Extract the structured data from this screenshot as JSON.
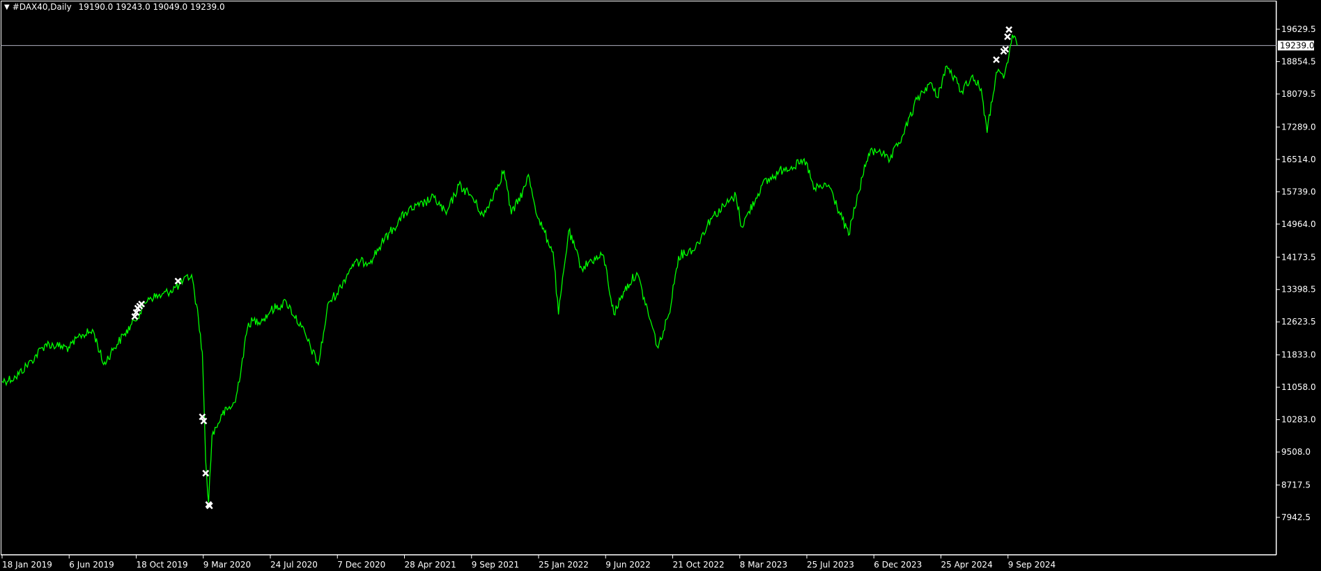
{
  "header": {
    "menu_icon": "triangle-down-icon",
    "symbol": "#DAX40,Daily",
    "ohlc": "19190.0 19243.0 19049.0 19239.0"
  },
  "colors": {
    "background": "#000000",
    "price_line": "#00ff00",
    "axis": "#ffffff",
    "marker": "#ffffff",
    "bid_line": "#b0b0c0"
  },
  "chart_data": {
    "type": "line",
    "series": [
      {
        "name": "",
        "points": [
          [
            "2019-01-18",
            11200
          ],
          [
            "2019-02-15",
            11300
          ],
          [
            "2019-03-20",
            11700
          ],
          [
            "2019-04-18",
            12100
          ],
          [
            "2019-05-10",
            12050
          ],
          [
            "2019-06-06",
            12000
          ],
          [
            "2019-06-28",
            12300
          ],
          [
            "2019-07-25",
            12400
          ],
          [
            "2019-08-15",
            11600
          ],
          [
            "2019-09-05",
            12000
          ],
          [
            "2019-09-25",
            12300
          ],
          [
            "2019-10-18",
            12650
          ],
          [
            "2019-11-15",
            13200
          ],
          [
            "2019-12-12",
            13250
          ],
          [
            "2020-01-17",
            13500
          ],
          [
            "2020-02-12",
            13750
          ],
          [
            "2020-02-26",
            12700
          ],
          [
            "2020-03-05",
            11900
          ],
          [
            "2020-03-12",
            9300
          ],
          [
            "2020-03-18",
            8300
          ],
          [
            "2020-03-25",
            9900
          ],
          [
            "2020-04-15",
            10400
          ],
          [
            "2020-05-12",
            10700
          ],
          [
            "2020-06-08",
            12600
          ],
          [
            "2020-07-10",
            12700
          ],
          [
            "2020-07-24",
            12900
          ],
          [
            "2020-08-25",
            13100
          ],
          [
            "2020-09-25",
            12500
          ],
          [
            "2020-10-30",
            11600
          ],
          [
            "2020-11-20",
            13100
          ],
          [
            "2020-12-07",
            13300
          ],
          [
            "2021-01-08",
            14000
          ],
          [
            "2021-02-15",
            14100
          ],
          [
            "2021-03-15",
            14600
          ],
          [
            "2021-04-28",
            15250
          ],
          [
            "2021-05-25",
            15400
          ],
          [
            "2021-06-25",
            15600
          ],
          [
            "2021-07-20",
            15200
          ],
          [
            "2021-08-15",
            15900
          ],
          [
            "2021-09-09",
            15650
          ],
          [
            "2021-10-05",
            15150
          ],
          [
            "2021-11-16",
            16250
          ],
          [
            "2021-12-01",
            15200
          ],
          [
            "2021-12-31",
            15900
          ],
          [
            "2022-01-05",
            16150
          ],
          [
            "2022-01-25",
            15100
          ],
          [
            "2022-02-25",
            14300
          ],
          [
            "2022-03-08",
            12800
          ],
          [
            "2022-03-29",
            14800
          ],
          [
            "2022-04-25",
            13900
          ],
          [
            "2022-05-15",
            14100
          ],
          [
            "2022-06-09",
            14200
          ],
          [
            "2022-06-30",
            12800
          ],
          [
            "2022-07-20",
            13350
          ],
          [
            "2022-08-16",
            13800
          ],
          [
            "2022-09-29",
            12000
          ],
          [
            "2022-10-21",
            12800
          ],
          [
            "2022-11-10",
            14200
          ],
          [
            "2022-12-15",
            14400
          ],
          [
            "2023-01-15",
            15100
          ],
          [
            "2023-03-08",
            15650
          ],
          [
            "2023-03-20",
            14900
          ],
          [
            "2023-05-01",
            15900
          ],
          [
            "2023-06-15",
            16300
          ],
          [
            "2023-07-31",
            16450
          ],
          [
            "2023-08-15",
            15800
          ],
          [
            "2023-09-15",
            15900
          ],
          [
            "2023-10-26",
            14700
          ],
          [
            "2023-11-15",
            15700
          ],
          [
            "2023-12-06",
            16650
          ],
          [
            "2023-12-29",
            16750
          ],
          [
            "2024-01-17",
            16450
          ],
          [
            "2024-02-15",
            17100
          ],
          [
            "2024-03-15",
            17950
          ],
          [
            "2024-04-10",
            18350
          ],
          [
            "2024-04-25",
            18000
          ],
          [
            "2024-05-15",
            18750
          ],
          [
            "2024-06-15",
            18150
          ],
          [
            "2024-07-05",
            18500
          ],
          [
            "2024-07-25",
            18200
          ],
          [
            "2024-08-06",
            17150
          ],
          [
            "2024-08-25",
            18600
          ],
          [
            "2024-09-09",
            18450
          ],
          [
            "2024-09-20",
            19000
          ],
          [
            "2024-09-27",
            19500
          ],
          [
            "2024-10-07",
            19239
          ]
        ]
      }
    ],
    "x_ticks": [
      "18 Jan 2019",
      "6 Jun 2019",
      "18 Oct 2019",
      "9 Mar 2020",
      "24 Jul 2020",
      "7 Dec 2020",
      "28 Apr 2021",
      "9 Sep 2021",
      "25 Jan 2022",
      "9 Jun 2022",
      "21 Oct 2022",
      "8 Mar 2023",
      "25 Jul 2023",
      "6 Dec 2023",
      "25 Apr 2024",
      "9 Sep 2024"
    ],
    "y_ticks": [
      "19629.5",
      "18854.5",
      "18079.5",
      "17289.0",
      "16514.0",
      "15739.0",
      "14964.0",
      "14173.5",
      "13398.5",
      "12623.5",
      "11833.0",
      "11058.0",
      "10283.0",
      "9508.0",
      "8717.5",
      "7942.5"
    ],
    "ylim": [
      7942.5,
      19629.5
    ],
    "current_price": "19239.0",
    "trade_markers": [
      [
        "2019-10-18",
        12750
      ],
      [
        "2019-10-21",
        12850
      ],
      [
        "2019-10-24",
        12950
      ],
      [
        "2019-10-28",
        13000
      ],
      [
        "2019-11-01",
        13050
      ],
      [
        "2020-01-15",
        13600
      ],
      [
        "2020-03-05",
        10350
      ],
      [
        "2020-03-08",
        10250
      ],
      [
        "2020-03-12",
        9000
      ],
      [
        "2020-03-18",
        8250
      ],
      [
        "2020-03-20",
        8220
      ],
      [
        "2024-08-25",
        18900
      ],
      [
        "2024-09-09",
        19100
      ],
      [
        "2024-09-13",
        19150
      ],
      [
        "2024-09-17",
        19450
      ],
      [
        "2024-09-20",
        19620
      ]
    ]
  }
}
